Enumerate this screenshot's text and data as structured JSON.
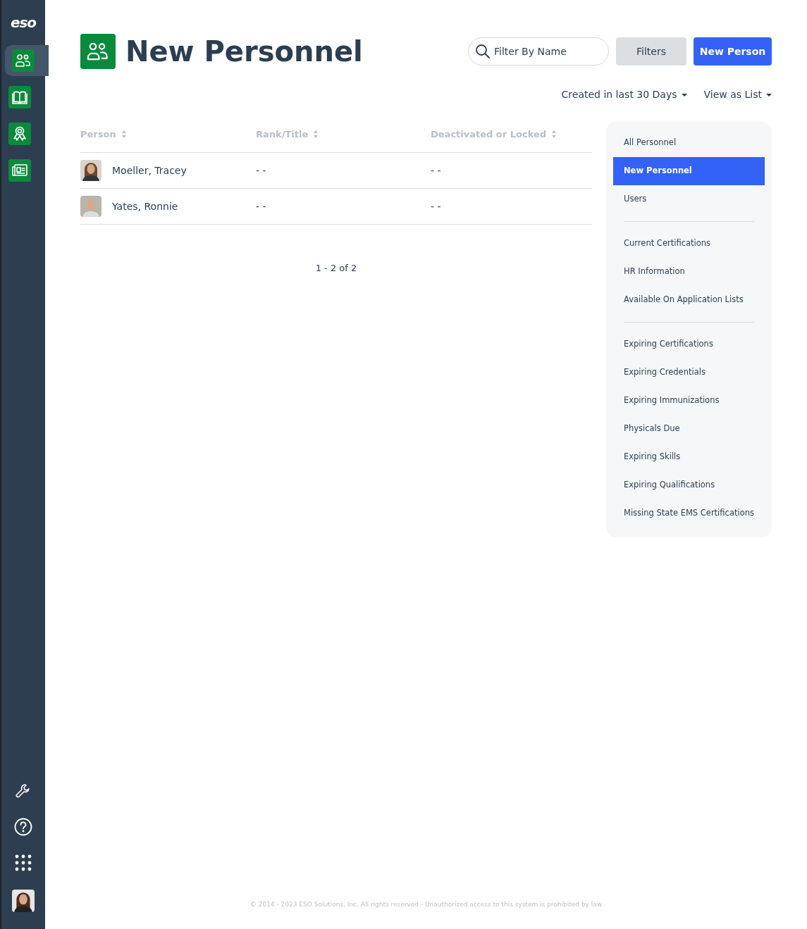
{
  "sidebar": {
    "logo": "eso",
    "items": [
      {
        "kind": "people",
        "selected": true
      },
      {
        "kind": "book",
        "selected": false
      },
      {
        "kind": "award",
        "selected": false
      },
      {
        "kind": "news",
        "selected": false
      }
    ],
    "bottom_items": [
      {
        "kind": "wrench"
      },
      {
        "kind": "help"
      },
      {
        "kind": "apps"
      },
      {
        "kind": "avatar"
      }
    ]
  },
  "header": {
    "title": "New Personnel",
    "search": {
      "placeholder": "Filter By Name"
    },
    "buttons": [
      {
        "label": "Filters",
        "kind": "secondary"
      },
      {
        "label": "New Person",
        "kind": "primary"
      }
    ],
    "dropdowns": [
      "Created in last 30 Days",
      "View as List"
    ]
  },
  "table": {
    "columns": [
      "Person",
      "Rank/Title",
      "Deactivated or Locked"
    ],
    "rows": [
      {
        "avatar": {
          "kind": "picture"
        },
        "cells": [
          "Moeller, Tracey",
          "- -",
          "- -"
        ]
      },
      {
        "avatar": {
          "kind": "picture"
        },
        "cells": [
          "Yates, Ronnie",
          "- -",
          "- -"
        ]
      }
    ]
  },
  "pagination": "1 - 2 of 2",
  "views": [
    [
      {
        "label": "All Personnel",
        "selected": false
      },
      {
        "label": "New Personnel",
        "selected": true
      },
      {
        "label": "Users",
        "selected": false
      }
    ],
    [
      {
        "label": "Current Certifications",
        "selected": false
      },
      {
        "label": "HR Information",
        "selected": false
      },
      {
        "label": "Available On Application Lists",
        "selected": false
      }
    ],
    [
      {
        "label": "Expiring Certifications",
        "selected": false
      },
      {
        "label": "Expiring Credentials",
        "selected": false
      },
      {
        "label": "Expiring Immunizations",
        "selected": false
      },
      {
        "label": "Physicals Due",
        "selected": false
      },
      {
        "label": "Expiring Skills",
        "selected": false
      },
      {
        "label": "Expiring Qualifications",
        "selected": false
      },
      {
        "label": "Missing State EMS Certifications",
        "selected": false
      }
    ]
  ],
  "footer": "© 2014 - 2023 ESO Solutions, Inc. All rights reserved - Unauthorized access to this system is prohibited by law"
}
